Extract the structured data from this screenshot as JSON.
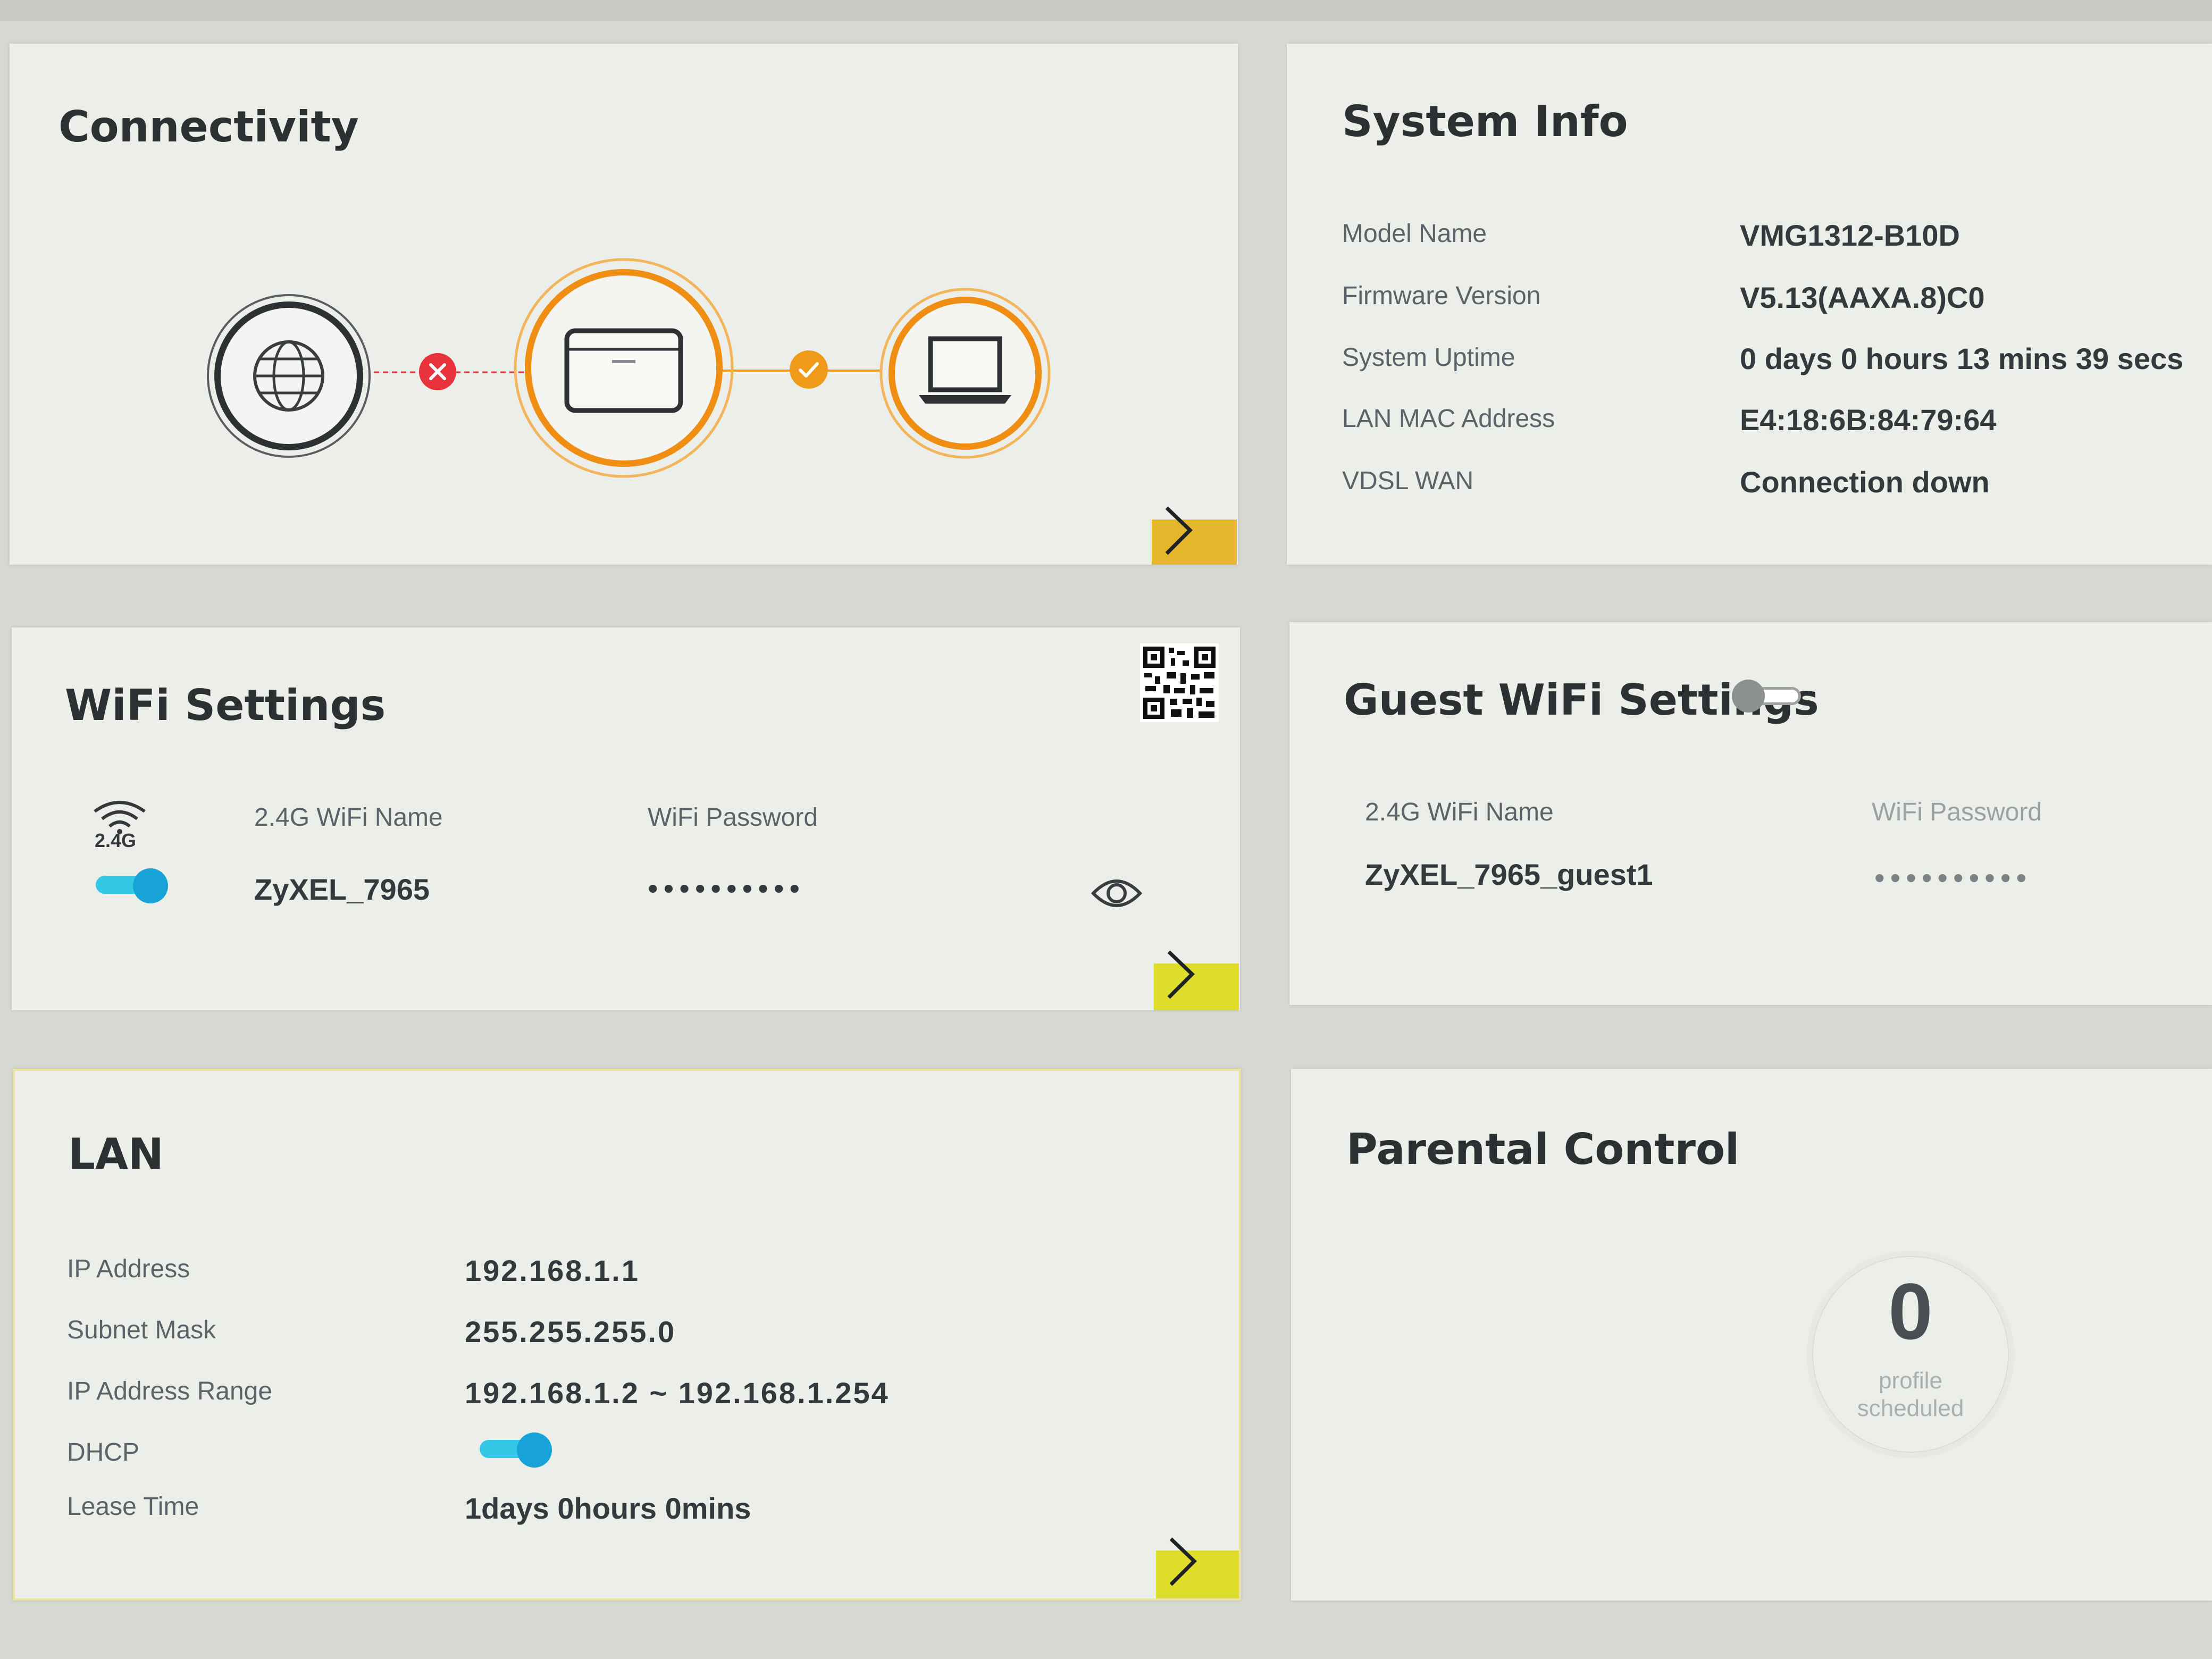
{
  "colors": {
    "accent_orange": "#f09a1a",
    "accent_yellow": "#dede2a",
    "toggle_blue": "#17a3d8",
    "error_red": "#e8323c"
  },
  "connectivity": {
    "title": "Connectivity",
    "internet_status": "error",
    "lan_status": "ok"
  },
  "system_info": {
    "title": "System Info",
    "rows": [
      {
        "label": "Model Name",
        "value": "VMG1312-B10D"
      },
      {
        "label": "Firmware Version",
        "value": "V5.13(AAXA.8)C0"
      },
      {
        "label": "System Uptime",
        "value": "0 days 0 hours 13 mins 39 secs"
      },
      {
        "label": "LAN MAC Address",
        "value": "E4:18:6B:84:79:64"
      },
      {
        "label": "VDSL WAN",
        "value": "Connection down"
      }
    ]
  },
  "wifi": {
    "title": "WiFi Settings",
    "band_label": "2.4G",
    "enabled": true,
    "name_label": "2.4G WiFi Name",
    "name_value": "ZyXEL_7965",
    "password_label": "WiFi Password",
    "password_value": "••••••••••"
  },
  "guest_wifi": {
    "title": "Guest WiFi Settings",
    "enabled": false,
    "name_label": "2.4G WiFi Name",
    "name_value": "ZyXEL_7965_guest1",
    "password_label": "WiFi Password",
    "password_value": "••••••••••"
  },
  "lan": {
    "title": "LAN",
    "rows": [
      {
        "label": "IP Address",
        "value": "192.168.1.1"
      },
      {
        "label": "Subnet Mask",
        "value": "255.255.255.0"
      },
      {
        "label": "IP Address Range",
        "value": "192.168.1.2 ~ 192.168.1.254"
      },
      {
        "label": "DHCP",
        "value": ""
      },
      {
        "label": "Lease Time",
        "value": "1days 0hours 0mins"
      }
    ],
    "dhcp_enabled": true
  },
  "parental_control": {
    "title": "Parental Control",
    "count": "0",
    "count_caption_line1": "profile",
    "count_caption_line2": "scheduled"
  }
}
